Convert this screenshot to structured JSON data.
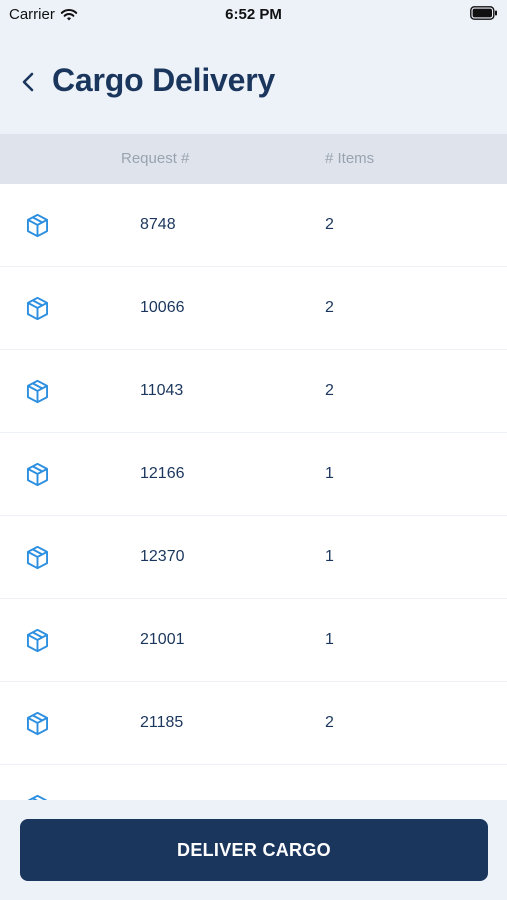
{
  "status_bar": {
    "carrier": "Carrier",
    "time": "6:52 PM"
  },
  "header": {
    "title": "Cargo Delivery"
  },
  "table": {
    "columns": [
      "Request #",
      "# Items"
    ],
    "rows": [
      {
        "request": "8748",
        "items": "2"
      },
      {
        "request": "10066",
        "items": "2"
      },
      {
        "request": "11043",
        "items": "2"
      },
      {
        "request": "12166",
        "items": "1"
      },
      {
        "request": "12370",
        "items": "1"
      },
      {
        "request": "21001",
        "items": "1"
      },
      {
        "request": "21185",
        "items": "2"
      },
      {
        "request": "",
        "items": ""
      }
    ]
  },
  "footer": {
    "deliver_label": "DELIVER CARGO"
  },
  "icons": {
    "row": "package-icon",
    "back": "chevron-left-icon",
    "wifi": "wifi-icon",
    "battery": "battery-icon"
  },
  "colors": {
    "primary": "#1B365D",
    "accent": "#2D8FE0",
    "background": "#EDF1F8",
    "header_bg": "#DFE4EC"
  }
}
